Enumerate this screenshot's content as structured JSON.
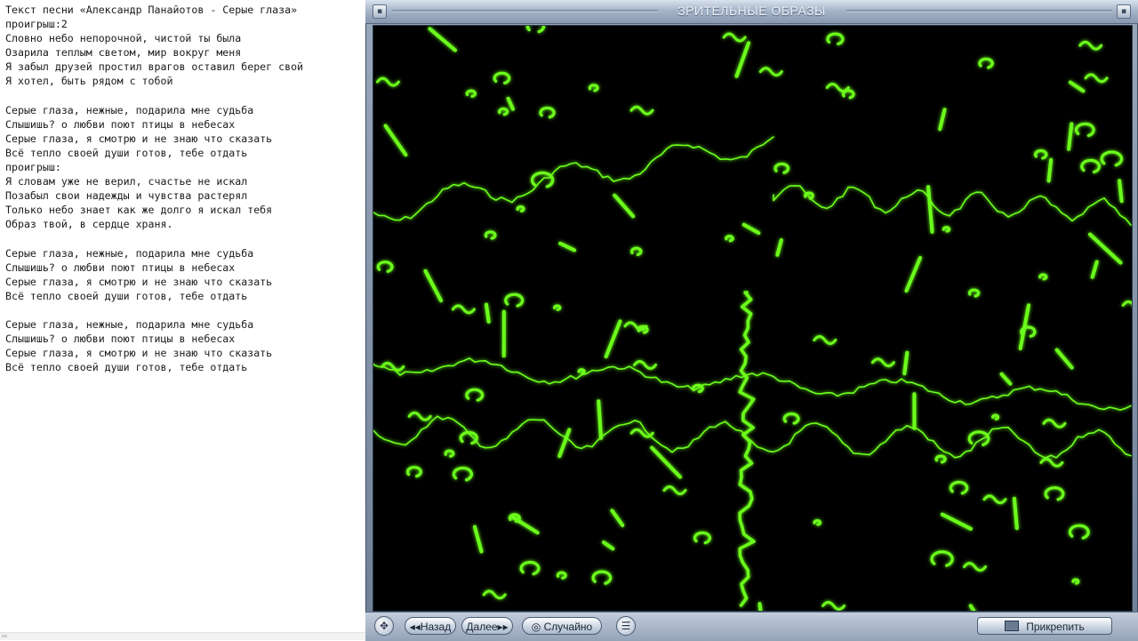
{
  "editor": {
    "lines": [
      "Текст песни «Александр Панайотов - Серые глаза»",
      "проигрыш:2",
      "Словно небо непорочной, чистой ты была",
      "Озарила теплым светом, мир вокруг меня",
      "Я забыл друзей простил врагов оставил берег свой",
      "Я хотел, быть рядом с тобой",
      "",
      "Серые глаза, нежные, подарила мне судьба",
      "Слышишь? о любви поют птицы в небесах",
      "Серые глаза, я смотрю и не знаю что сказать",
      "Всё тепло своей души готов, тебе отдать",
      "проигрыш:",
      "Я словам уже не верил, счастье не искал",
      "Позабыл свои надежды и чувства растерял",
      "Только небо знает как же долго я искал тебя",
      "Образ твой, в сердце храня.",
      "",
      "Серые глаза, нежные, подарила мне судьба",
      "Слышишь? о любви поют птицы в небесах",
      "Серые глаза, я смотрю и не знаю что сказать",
      "Всё тепло своей души готов, тебе отдать",
      "",
      "Серые глаза, нежные, подарила мне судьба",
      "Слышишь? о любви поют птицы в небесах",
      "Серые глаза, я смотрю и не знаю что сказать",
      "Всё тепло своей души готов, тебе отдать"
    ]
  },
  "player": {
    "title": "ЗРИТЕЛЬНЫЕ ОБРАЗЫ",
    "controls": {
      "back_label": "◂◂Назад",
      "next_label": "Далее▸▸",
      "shuffle_label": "◎ Случайно",
      "pin_label": "Прикрепить"
    },
    "viz_color": "#6cff1a",
    "nav_icon": "compass-icon",
    "menu_icon": "menu-icon"
  }
}
